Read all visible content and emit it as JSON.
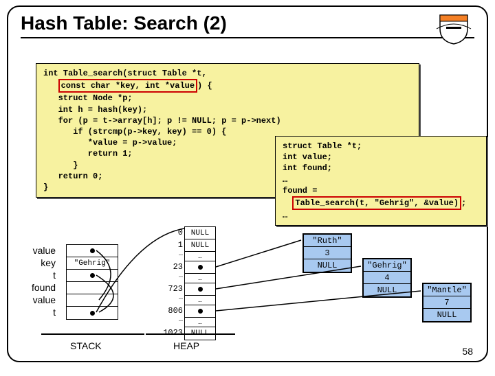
{
  "title": "Hash Table: Search (2)",
  "page_number": "58",
  "code_main": {
    "l1": "int Table_search(struct Table *t,",
    "l2_pre": "   ",
    "l2_box": "const char *key, int *value",
    "l2_post": ") {",
    "l3": "   struct Node *p;",
    "l4": "   int h = hash(key);",
    "l5": "   for (p = t->array[h]; p != NULL; p = p->next)",
    "l6": "      if (strcmp(p->key, key) == 0) {",
    "l7": "         *value = p->value;",
    "l8": "         return 1;",
    "l9": "      }",
    "l10": "   return 0;",
    "l11": "}"
  },
  "code_caller": {
    "l1": "struct Table *t;",
    "l2": "int value;",
    "l3": "int found;",
    "l4": "…",
    "l5": "found =",
    "l6_pre": "  ",
    "l6_box": "Table_search(t, \"Gehrig\", &value)",
    "l6_post": ";",
    "l7": "…"
  },
  "stack": {
    "vars": [
      "value",
      "key",
      "t",
      "found",
      "value",
      "t"
    ],
    "key_value": "\"Gehrig\"",
    "label": "STACK"
  },
  "heap": {
    "label": "HEAP",
    "indices": [
      "0",
      "1",
      "23",
      "723",
      "806",
      "1023"
    ],
    "null": "NULL",
    "dots": "…"
  },
  "nodes": {
    "ruth": {
      "key": "\"Ruth\"",
      "value": "3",
      "next": "NULL"
    },
    "gehrig": {
      "key": "\"Gehrig\"",
      "value": "4",
      "next": "NULL"
    },
    "mantle": {
      "key": "\"Mantle\"",
      "value": "7",
      "next": "NULL"
    }
  }
}
